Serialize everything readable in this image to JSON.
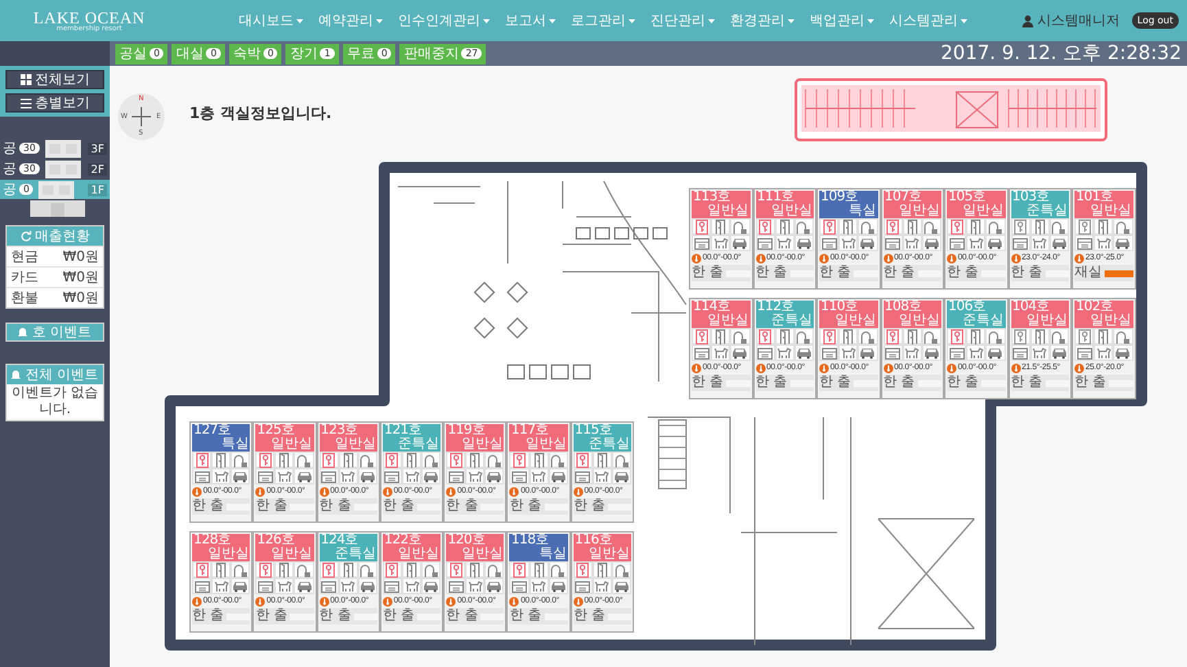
{
  "header": {
    "logo": "LAKE OCEAN",
    "logo_subtitle": "membership resort",
    "nav": [
      {
        "label": "대시보드"
      },
      {
        "label": "예약관리"
      },
      {
        "label": "인수인계관리"
      },
      {
        "label": "보고서"
      },
      {
        "label": "로그관리"
      },
      {
        "label": "진단관리"
      },
      {
        "label": "환경관리"
      },
      {
        "label": "백업관리"
      },
      {
        "label": "시스템관리"
      }
    ],
    "user": "시스템매니저",
    "logout": "Log out"
  },
  "status_bar": {
    "counters": [
      {
        "label": "공실",
        "count": "0"
      },
      {
        "label": "대실",
        "count": "0"
      },
      {
        "label": "숙박",
        "count": "0"
      },
      {
        "label": "장기",
        "count": "1"
      },
      {
        "label": "무료",
        "count": "0"
      },
      {
        "label": "판매중지",
        "count": "27"
      }
    ],
    "datetime": "2017. 9. 12. 오후 2:28:32"
  },
  "sidebar": {
    "view_buttons": [
      {
        "kind": "grid",
        "label": "전체보기"
      },
      {
        "kind": "list",
        "label": "층별보기"
      }
    ],
    "floors": [
      {
        "label": "공",
        "count": "30",
        "floor": "3F",
        "selected": false
      },
      {
        "label": "공",
        "count": "30",
        "floor": "2F",
        "selected": false
      },
      {
        "label": "공",
        "count": "0",
        "floor": "1F",
        "selected": true
      }
    ],
    "sales": {
      "title": "매출현황",
      "rows": [
        {
          "label": "현금",
          "amount": "₩0원"
        },
        {
          "label": "카드",
          "amount": "₩0원"
        },
        {
          "label": "환불",
          "amount": "₩0원"
        }
      ]
    },
    "room_event": {
      "title": "호 이벤트"
    },
    "all_events": {
      "title": "전체 이벤트",
      "message": "이벤트가 없습니다."
    }
  },
  "floor_plan": {
    "title": "1층 객실정보입니다.",
    "compass": {
      "north": "N",
      "west": "W",
      "east": "E",
      "south": "S"
    },
    "room_groups": [
      {
        "rows": [
          [
            {
              "number": "113호",
              "type": "일반실",
              "color": "#f26b7a",
              "key_active": true,
              "temperature": "00.0°-00.0°",
              "status": "한 출",
              "occupied": false
            },
            {
              "number": "111호",
              "type": "일반실",
              "color": "#f26b7a",
              "key_active": true,
              "temperature": "00.0°-00.0°",
              "status": "한 출",
              "occupied": false
            },
            {
              "number": "109호",
              "type": "특실",
              "color": "#4a6db4",
              "key_active": true,
              "temperature": "00.0°-00.0°",
              "status": "한 출",
              "occupied": false
            },
            {
              "number": "107호",
              "type": "일반실",
              "color": "#f26b7a",
              "key_active": true,
              "temperature": "00.0°-00.0°",
              "status": "한 출",
              "occupied": false
            },
            {
              "number": "105호",
              "type": "일반실",
              "color": "#f26b7a",
              "key_active": true,
              "temperature": "00.0°-00.0°",
              "status": "한 출",
              "occupied": false
            },
            {
              "number": "103호",
              "type": "준특실",
              "color": "#4bb3b8",
              "key_active": false,
              "temperature": "23.0°-24.0°",
              "status": "한 출",
              "occupied": false
            },
            {
              "number": "101호",
              "type": "일반실",
              "color": "#f26b7a",
              "key_active": false,
              "temperature": "23.0°-25.0°",
              "status": "재실",
              "occupied": true
            }
          ],
          [
            {
              "number": "114호",
              "type": "일반실",
              "color": "#f26b7a",
              "key_active": true,
              "temperature": "00.0°-00.0°",
              "status": "한 출",
              "occupied": false
            },
            {
              "number": "112호",
              "type": "준특실",
              "color": "#4bb3b8",
              "key_active": true,
              "temperature": "00.0°-00.0°",
              "status": "한 출",
              "occupied": false
            },
            {
              "number": "110호",
              "type": "일반실",
              "color": "#f26b7a",
              "key_active": true,
              "temperature": "00.0°-00.0°",
              "status": "한 출",
              "occupied": false
            },
            {
              "number": "108호",
              "type": "일반실",
              "color": "#f26b7a",
              "key_active": true,
              "temperature": "00.0°-00.0°",
              "status": "한 출",
              "occupied": false
            },
            {
              "number": "106호",
              "type": "준특실",
              "color": "#4bb3b8",
              "key_active": true,
              "temperature": "00.0°-00.0°",
              "status": "한 출",
              "occupied": false
            },
            {
              "number": "104호",
              "type": "일반실",
              "color": "#f26b7a",
              "key_active": false,
              "temperature": "21.5°-25.5°",
              "status": "한 출",
              "occupied": false
            },
            {
              "number": "102호",
              "type": "일반실",
              "color": "#f26b7a",
              "key_active": false,
              "temperature": "25.0°-20.0°",
              "status": "한 출",
              "occupied": false
            }
          ]
        ]
      },
      {
        "rows": [
          [
            {
              "number": "127호",
              "type": "특실",
              "color": "#4a6db4",
              "key_active": true,
              "temperature": "00.0°-00.0°",
              "status": "한 출",
              "occupied": false
            },
            {
              "number": "125호",
              "type": "일반실",
              "color": "#f26b7a",
              "key_active": true,
              "temperature": "00.0°-00.0°",
              "status": "한 출",
              "occupied": false
            },
            {
              "number": "123호",
              "type": "일반실",
              "color": "#f26b7a",
              "key_active": true,
              "temperature": "00.0°-00.0°",
              "status": "한 출",
              "occupied": false
            },
            {
              "number": "121호",
              "type": "준특실",
              "color": "#4bb3b8",
              "key_active": true,
              "temperature": "00.0°-00.0°",
              "status": "한 출",
              "occupied": false
            },
            {
              "number": "119호",
              "type": "일반실",
              "color": "#f26b7a",
              "key_active": true,
              "temperature": "00.0°-00.0°",
              "status": "한 출",
              "occupied": false
            },
            {
              "number": "117호",
              "type": "일반실",
              "color": "#f26b7a",
              "key_active": true,
              "temperature": "00.0°-00.0°",
              "status": "한 출",
              "occupied": false
            },
            {
              "number": "115호",
              "type": "준특실",
              "color": "#4bb3b8",
              "key_active": true,
              "temperature": "00.0°-00.0°",
              "status": "한 출",
              "occupied": false
            }
          ],
          [
            {
              "number": "128호",
              "type": "일반실",
              "color": "#f26b7a",
              "key_active": true,
              "temperature": "00.0°-00.0°",
              "status": "한 출",
              "occupied": false
            },
            {
              "number": "126호",
              "type": "일반실",
              "color": "#f26b7a",
              "key_active": true,
              "temperature": "00.0°-00.0°",
              "status": "한 출",
              "occupied": false
            },
            {
              "number": "124호",
              "type": "준특실",
              "color": "#4bb3b8",
              "key_active": true,
              "temperature": "00.0°-00.0°",
              "status": "한 출",
              "occupied": false
            },
            {
              "number": "122호",
              "type": "일반실",
              "color": "#f26b7a",
              "key_active": true,
              "temperature": "00.0°-00.0°",
              "status": "한 출",
              "occupied": false
            },
            {
              "number": "120호",
              "type": "일반실",
              "color": "#f26b7a",
              "key_active": true,
              "temperature": "00.0°-00.0°",
              "status": "한 출",
              "occupied": false
            },
            {
              "number": "118호",
              "type": "특실",
              "color": "#4a6db4",
              "key_active": true,
              "temperature": "00.0°-00.0°",
              "status": "한 출",
              "occupied": false
            },
            {
              "number": "116호",
              "type": "일반실",
              "color": "#f26b7a",
              "key_active": true,
              "temperature": "00.0°-00.0°",
              "status": "한 출",
              "occupied": false
            }
          ]
        ]
      }
    ]
  }
}
